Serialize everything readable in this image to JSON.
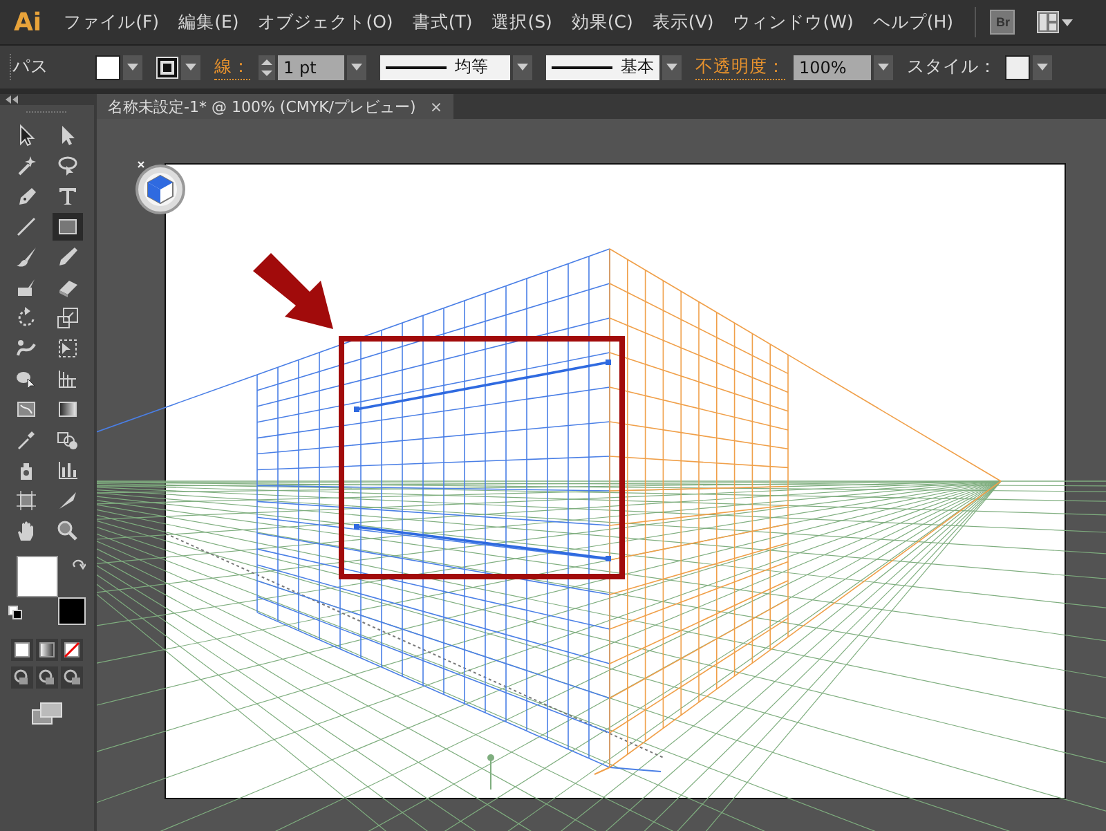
{
  "menu": {
    "logo": "Ai",
    "items": [
      "ファイル(F)",
      "編集(E)",
      "オブジェクト(O)",
      "書式(T)",
      "選択(S)",
      "効果(C)",
      "表示(V)",
      "ウィンドウ(W)",
      "ヘルプ(H)"
    ],
    "bridge_button": "Br"
  },
  "control_bar": {
    "selection_label": "パス",
    "stroke_label": "線：",
    "stroke_weight": "1 pt",
    "profile": "均等",
    "brush": "基本",
    "opacity_label": "不透明度：",
    "opacity": "100%",
    "style_label": "スタイル："
  },
  "document_tab": {
    "title": "名称未設定-1* @ 100% (CMYK/プレビュー)",
    "close": "×"
  },
  "tools": [
    {
      "selected": false
    },
    {
      "selected": false
    },
    {
      "selected": false
    },
    {
      "selected": false
    },
    {
      "selected": false
    },
    {
      "selected": false
    },
    {
      "selected": false
    },
    {
      "selected": true
    },
    {
      "selected": false
    },
    {
      "selected": false
    },
    {
      "selected": false
    },
    {
      "selected": false
    },
    {
      "selected": false
    },
    {
      "selected": false
    },
    {
      "selected": false
    },
    {
      "selected": false
    },
    {
      "selected": false
    },
    {
      "selected": false
    },
    {
      "selected": false
    },
    {
      "selected": false
    },
    {
      "selected": false
    },
    {
      "selected": false
    },
    {
      "selected": false
    },
    {
      "selected": false
    },
    {
      "selected": false
    },
    {
      "selected": false
    },
    {
      "selected": false
    },
    {
      "selected": false
    }
  ]
}
